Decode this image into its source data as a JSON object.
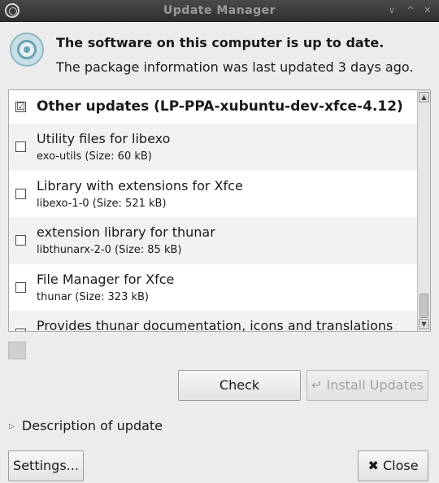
{
  "window": {
    "title": "Update Manager",
    "controls": [
      "∨",
      "^",
      "✕"
    ]
  },
  "header": {
    "headline": "The software on this computer is up to date.",
    "subline": "The package information was last updated 3 days ago."
  },
  "updates": {
    "group": {
      "label": "Other updates (LP-PPA-xubuntu-dev-xfce-4.12)",
      "checked": "☑"
    },
    "items": [
      {
        "title": "Utility files for libexo",
        "detail": "exo-utils (Size: 60 kB)"
      },
      {
        "title": "Library with extensions for Xfce",
        "detail": "libexo-1-0 (Size: 521 kB)"
      },
      {
        "title": "extension library for thunar",
        "detail": "libthunarx-2-0 (Size: 85 kB)"
      },
      {
        "title": "File Manager for Xfce",
        "detail": "thunar (Size: 323 kB)"
      },
      {
        "title": "Provides thunar documentation, icons and translations",
        "detail": ""
      }
    ]
  },
  "buttons": {
    "check": "Check",
    "install_icon": "↵",
    "install": "Install Updates",
    "settings": "Settings...",
    "close_icon": "✖",
    "close": "Close"
  },
  "description_expander": "Description of update",
  "icons": {
    "scroll_up": "▲",
    "scroll_down": "▼",
    "expander_arrow": "▷"
  }
}
